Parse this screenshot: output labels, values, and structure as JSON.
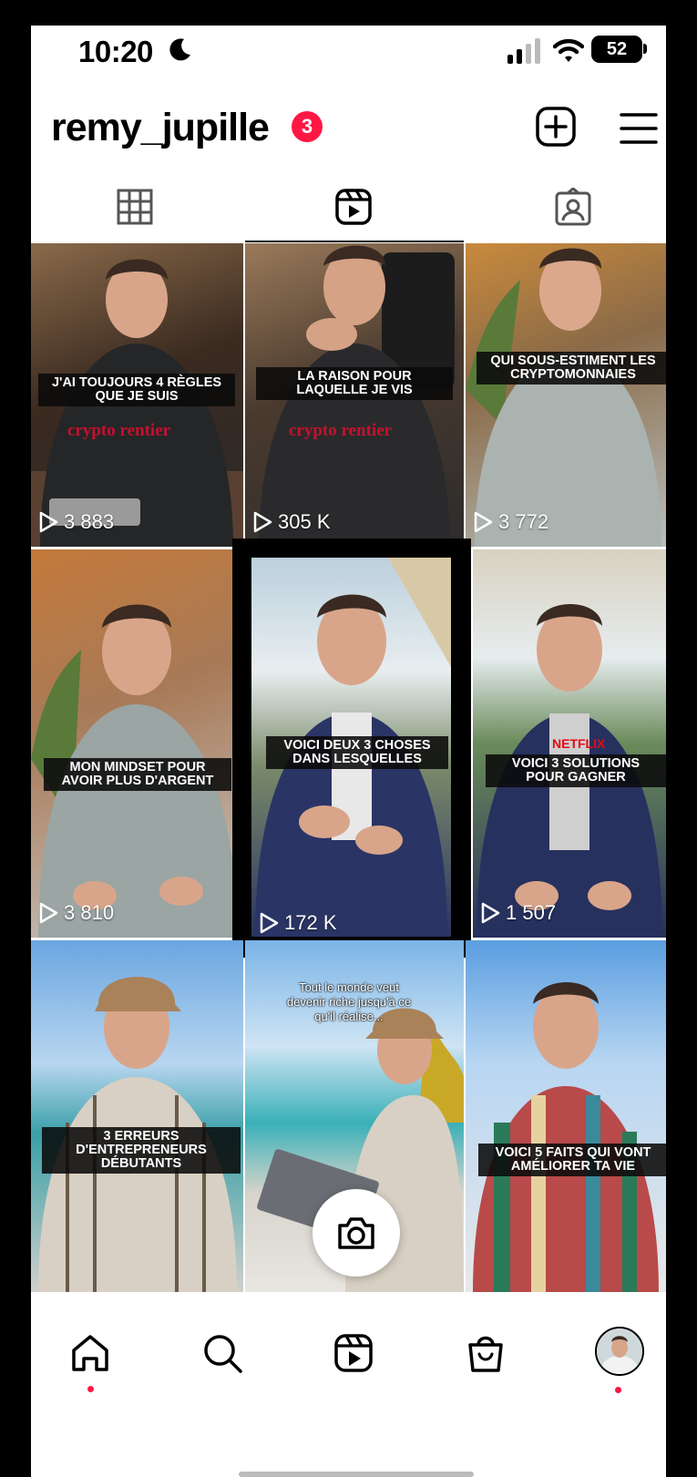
{
  "status_bar": {
    "time": "10:20",
    "battery": "52"
  },
  "profile": {
    "username": "remy_jupille",
    "notification_count": "3"
  },
  "tabs": [
    "grid-icon",
    "reels-icon",
    "tagged-icon"
  ],
  "active_tab": "reels",
  "reels": [
    {
      "caption": "J'AI TOUJOURS 4 RÈGLES\nQUE JE SUIS",
      "views": "3 883"
    },
    {
      "caption": "LA RAISON POUR\nLAQUELLE JE VIS",
      "views": "305 K"
    },
    {
      "caption": "QUI SOUS-ESTIMENT LES\nCRYPTOMONNAIES",
      "views": "3 772"
    },
    {
      "caption": "MON MINDSET POUR\nAVOIR PLUS D'ARGENT",
      "views": "3 810"
    },
    {
      "caption": "VOICI DEUX 3 CHOSES\nDANS LESQUELLES",
      "views": "172 K"
    },
    {
      "caption": "VOICI 3 SOLUTIONS\nPOUR GAGNER",
      "views": "1 507"
    },
    {
      "caption": "3 ERREURS\nD'ENTREPRENEURS\nDÉBUTANTS",
      "views": ""
    },
    {
      "caption": "Tout le monde veut\ndevenir riche jusqu'à ce\nqu'il réalise...",
      "views": ""
    },
    {
      "caption": "VOICI 5 FAITS QUI VONT\nAMÉLIORER TA VIE",
      "views": ""
    }
  ],
  "shirt_text": {
    "crypto_rentier": "crypto rentier",
    "netflix": "NETFLIX"
  },
  "bottom_nav": [
    "home-icon",
    "search-icon",
    "reels-icon",
    "shop-icon",
    "profile-avatar"
  ],
  "colors": {
    "accent": "#ff1744",
    "text": "#000000"
  }
}
